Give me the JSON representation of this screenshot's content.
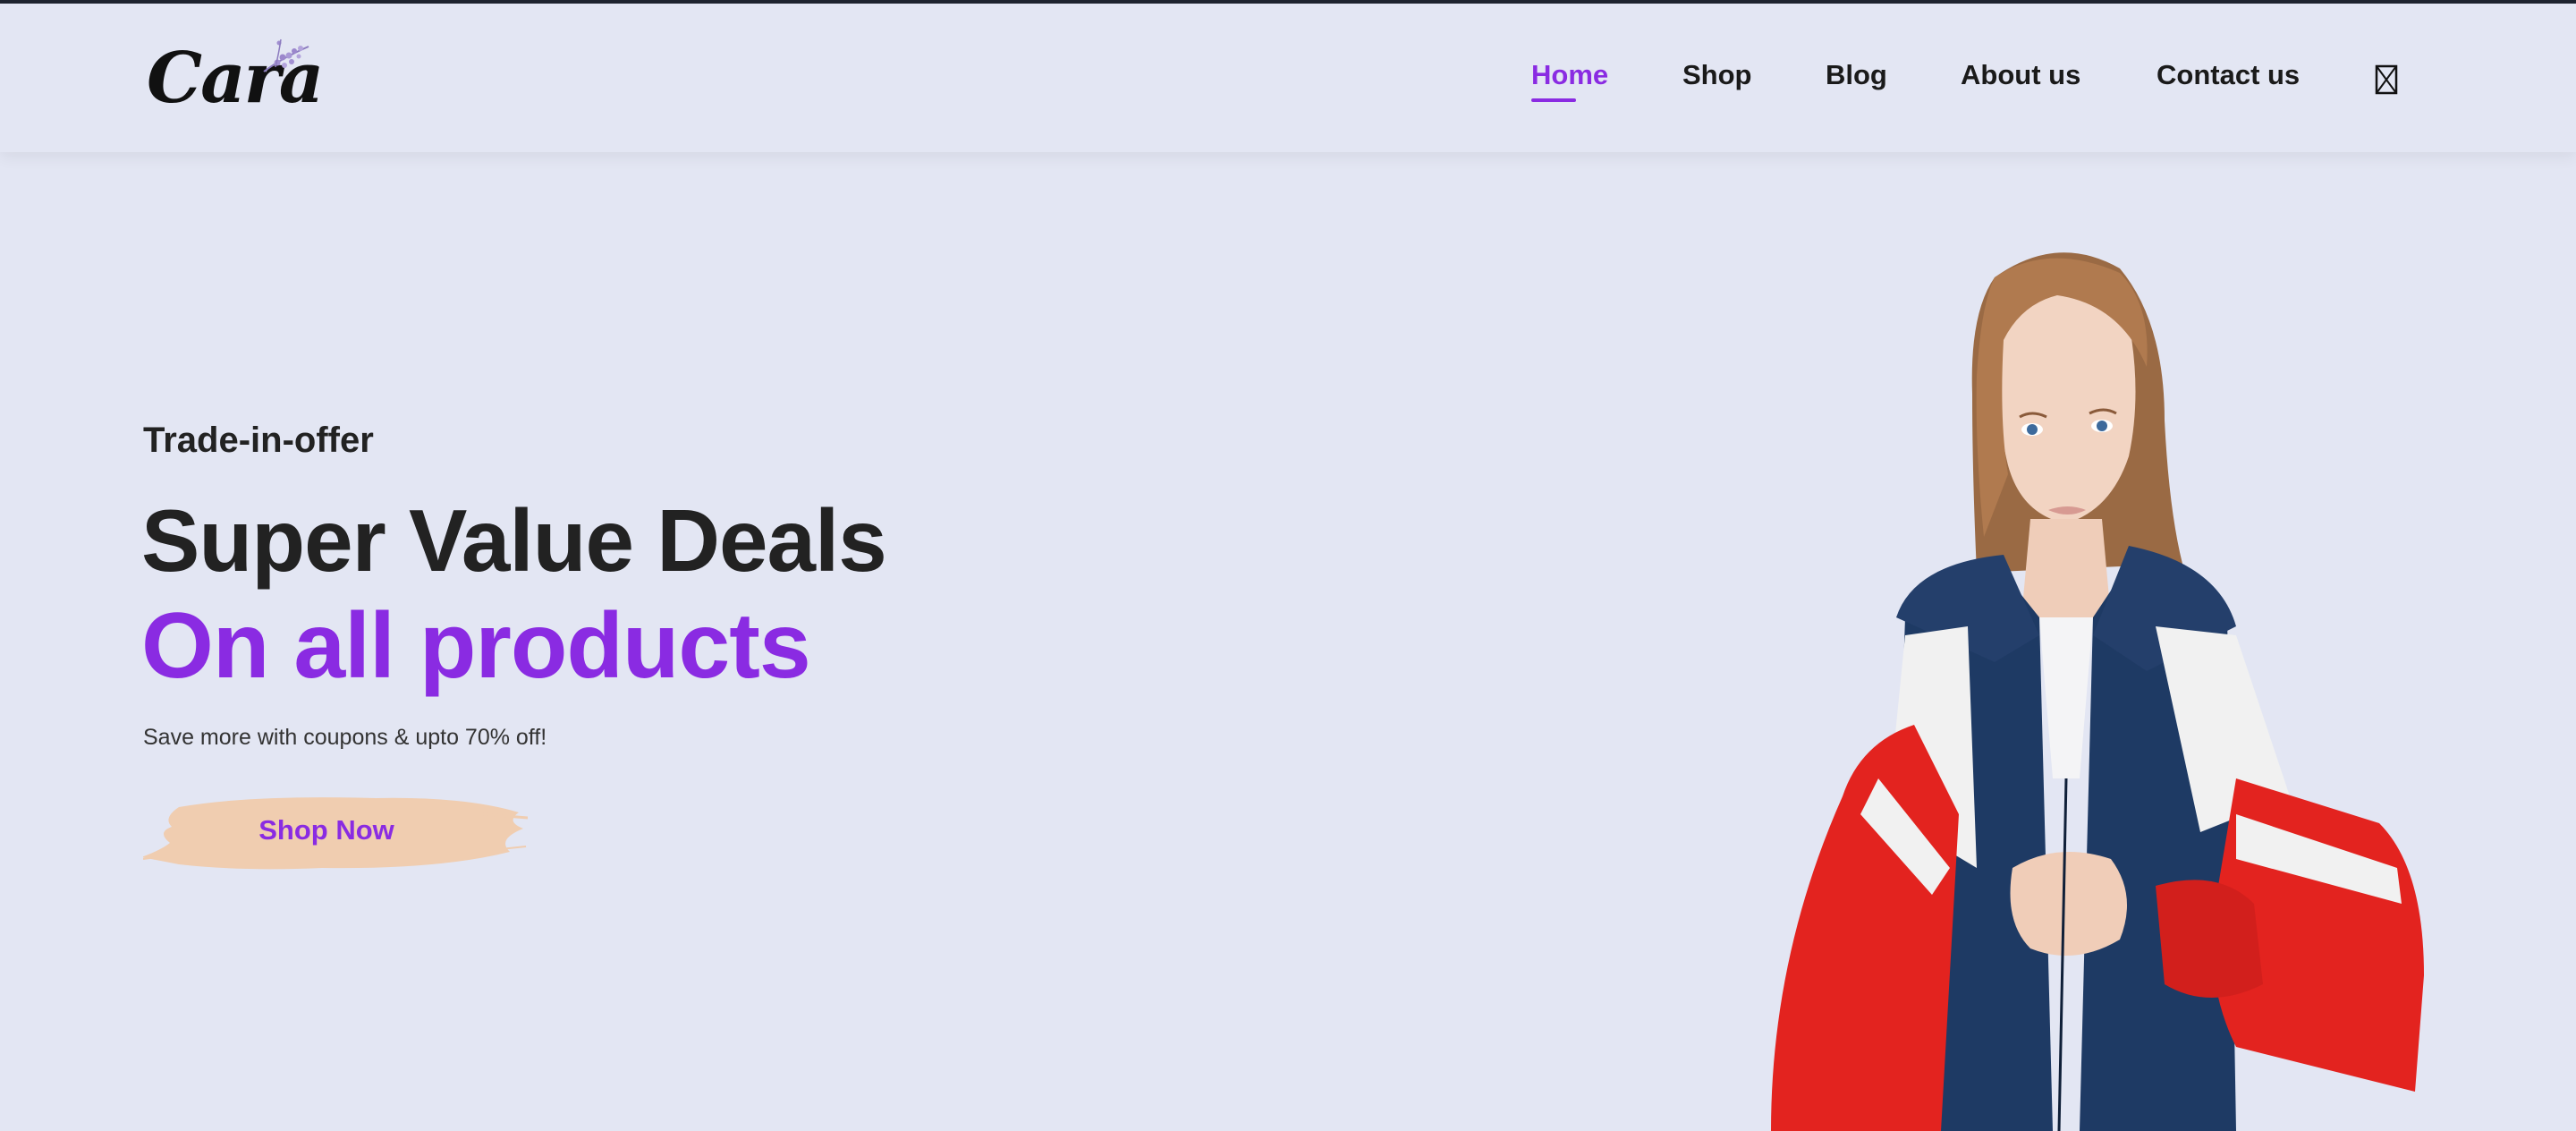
{
  "brand": {
    "logo_text": "Cara"
  },
  "nav": {
    "items": [
      {
        "label": "Home",
        "active": true
      },
      {
        "label": "Shop",
        "active": false
      },
      {
        "label": "Blog",
        "active": false
      },
      {
        "label": "About us",
        "active": false
      },
      {
        "label": "Contact us",
        "active": false
      }
    ],
    "cart_icon": "shopping-bag-icon"
  },
  "hero": {
    "eyebrow": "Trade-in-offer",
    "headline": "Super Value Deals",
    "headline_accent": "On all products",
    "subtext": "Save more with coupons & upto 70% off!",
    "cta_label": "Shop Now",
    "image": "woman-in-track-jacket"
  },
  "colors": {
    "background": "#e3e6f3",
    "accent": "#8a2be2",
    "cta_brush": "#f0cdb0",
    "text_dark": "#222222"
  }
}
